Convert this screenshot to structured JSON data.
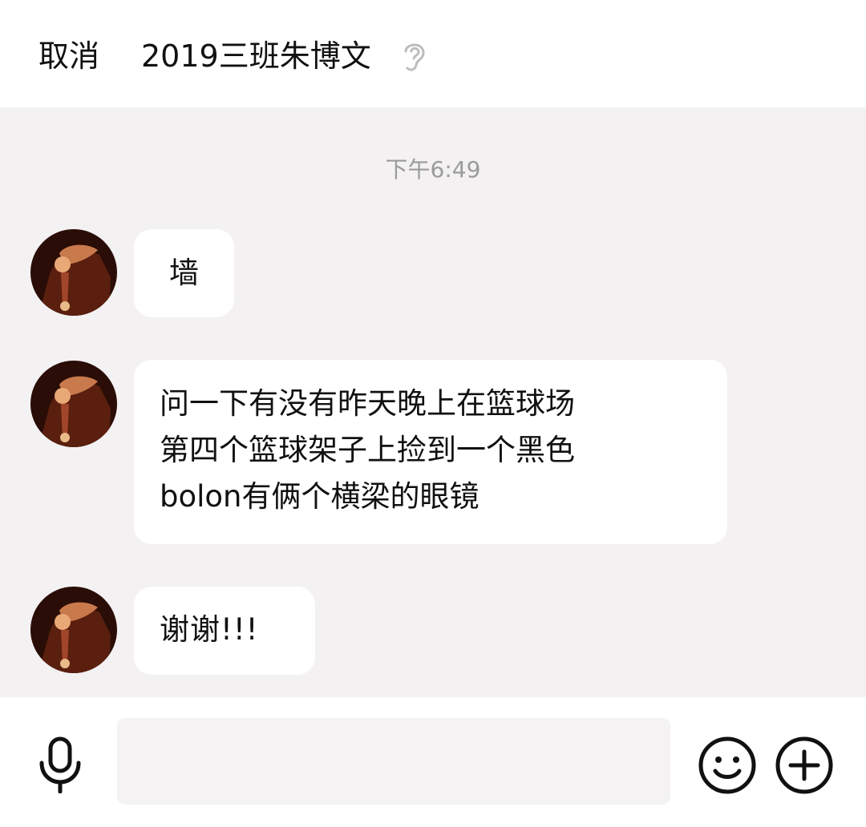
{
  "header": {
    "cancel_label": "取消",
    "title": "2019三班朱博文",
    "listen_mode_icon": "ear-icon"
  },
  "chat": {
    "timestamp": "下午6:49",
    "messages": [
      {
        "lines": [
          "墙"
        ],
        "avatar_icon": "contact-avatar"
      },
      {
        "lines": [
          "问一下有没有昨天晚上在篮球场",
          "第四个篮球架子上捡到一个黑色",
          "bolon有俩个横梁的眼镜"
        ],
        "avatar_icon": "contact-avatar"
      },
      {
        "lines": [
          "谢谢!!!"
        ],
        "avatar_icon": "contact-avatar"
      }
    ]
  },
  "composer": {
    "voice_icon": "microphone-icon",
    "input_value": "",
    "emoji_icon": "smiley-icon",
    "more_icon": "plus-circle-icon"
  },
  "colors": {
    "header_bg": "#ffffff",
    "chat_bg": "#f3f1f2",
    "bubble_bg": "#ffffff",
    "timestamp": "#9b9b9b",
    "ear_icon": "#bdbdbd"
  }
}
